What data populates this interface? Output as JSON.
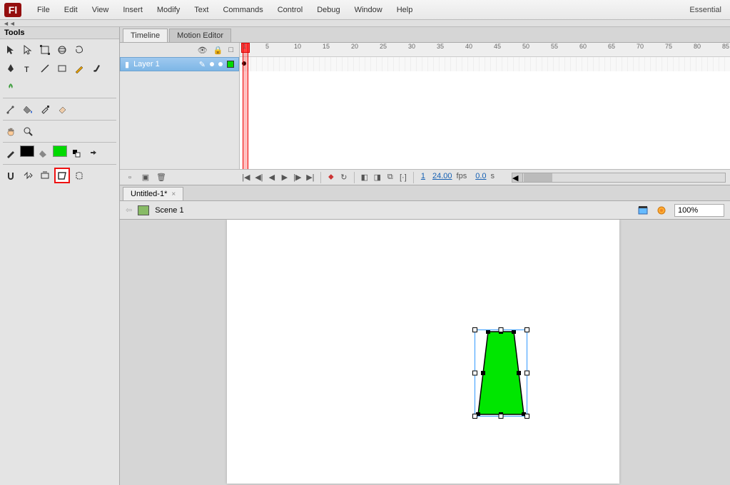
{
  "app": {
    "logo": "Fl",
    "workspace": "Essential"
  },
  "menu": [
    "File",
    "Edit",
    "View",
    "Insert",
    "Modify",
    "Text",
    "Commands",
    "Control",
    "Debug",
    "Window",
    "Help"
  ],
  "tools_panel": {
    "title": "Tools"
  },
  "timeline": {
    "tabs": [
      "Timeline",
      "Motion Editor"
    ],
    "layer": {
      "name": "Layer 1"
    },
    "ruler_marks": [
      1,
      5,
      10,
      15,
      20,
      25,
      30,
      35,
      40,
      45,
      50,
      55,
      60,
      65,
      70,
      75,
      80,
      85
    ],
    "status": {
      "frame": "1",
      "fps": "24.00",
      "fps_unit": "fps",
      "time": "0.0",
      "time_unit": "s"
    }
  },
  "document": {
    "tab": "Untitled-1*"
  },
  "editbar": {
    "scene": "Scene 1",
    "zoom": "100%"
  },
  "colors": {
    "fill": "#00d900",
    "stroke": "#000000"
  }
}
